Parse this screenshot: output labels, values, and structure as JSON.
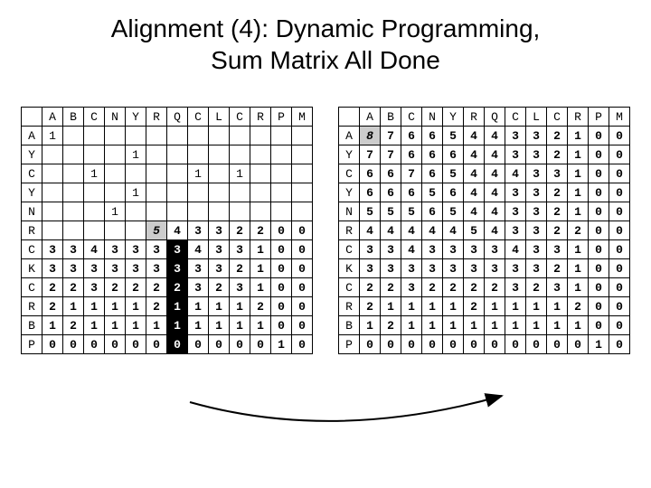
{
  "title_line1": "Alignment (4): Dynamic Programming,",
  "title_line2": "Sum Matrix All Done",
  "left_table": {
    "col_hdr": [
      "",
      "A",
      "B",
      "C",
      "N",
      "Y",
      "R",
      "Q",
      "C",
      "L",
      "C",
      "R",
      "P",
      "M"
    ],
    "rows": [
      {
        "hdr": "A",
        "cells": [
          "1",
          "",
          "",
          "",
          "",
          "",
          "",
          "",
          "",
          "",
          "",
          "",
          ""
        ]
      },
      {
        "hdr": "Y",
        "cells": [
          "",
          "",
          "",
          "",
          "1",
          "",
          "",
          "",
          "",
          "",
          "",
          "",
          ""
        ]
      },
      {
        "hdr": "C",
        "cells": [
          "",
          "",
          "1",
          "",
          "",
          "",
          "",
          "1",
          "",
          "1",
          "",
          "",
          ""
        ]
      },
      {
        "hdr": "Y",
        "cells": [
          "",
          "",
          "",
          "",
          "1",
          "",
          "",
          "",
          "",
          "",
          "",
          "",
          ""
        ]
      },
      {
        "hdr": "N",
        "cells": [
          "",
          "",
          "",
          "1",
          "",
          "",
          "",
          "",
          "",
          "",
          "",
          "",
          ""
        ]
      },
      {
        "hdr": "R",
        "cells": [
          "",
          "",
          "",
          "",
          "",
          "5",
          "4",
          "3",
          "3",
          "2",
          "2",
          "0",
          "0"
        ],
        "highlight_idx": 5,
        "highlight_kind": "grey"
      },
      {
        "hdr": "C",
        "cells": [
          "3",
          "3",
          "4",
          "3",
          "3",
          "3",
          "3",
          "4",
          "3",
          "3",
          "1",
          "0",
          "0"
        ],
        "highlight_idx": 6,
        "highlight_kind": "dark"
      },
      {
        "hdr": "K",
        "cells": [
          "3",
          "3",
          "3",
          "3",
          "3",
          "3",
          "3",
          "3",
          "3",
          "2",
          "1",
          "0",
          "0"
        ],
        "highlight_idx": 6,
        "highlight_kind": "dark"
      },
      {
        "hdr": "C",
        "cells": [
          "2",
          "2",
          "3",
          "2",
          "2",
          "2",
          "2",
          "3",
          "2",
          "3",
          "1",
          "0",
          "0"
        ],
        "highlight_idx": 6,
        "highlight_kind": "dark"
      },
      {
        "hdr": "R",
        "cells": [
          "2",
          "1",
          "1",
          "1",
          "1",
          "2",
          "1",
          "1",
          "1",
          "1",
          "2",
          "0",
          "0"
        ],
        "highlight_idx": 6,
        "highlight_kind": "dark"
      },
      {
        "hdr": "B",
        "cells": [
          "1",
          "2",
          "1",
          "1",
          "1",
          "1",
          "1",
          "1",
          "1",
          "1",
          "1",
          "0",
          "0"
        ],
        "highlight_idx": 6,
        "highlight_kind": "dark"
      },
      {
        "hdr": "P",
        "cells": [
          "0",
          "0",
          "0",
          "0",
          "0",
          "0",
          "0",
          "0",
          "0",
          "0",
          "0",
          "1",
          "0"
        ],
        "highlight_idx": 6,
        "highlight_kind": "dark"
      }
    ]
  },
  "right_table": {
    "col_hdr": [
      "",
      "A",
      "B",
      "C",
      "N",
      "Y",
      "R",
      "Q",
      "C",
      "L",
      "C",
      "R",
      "P",
      "M"
    ],
    "rows": [
      {
        "hdr": "A",
        "cells": [
          "8",
          "7",
          "6",
          "6",
          "5",
          "4",
          "4",
          "3",
          "3",
          "2",
          "1",
          "0",
          "0"
        ],
        "highlight_idx": 0,
        "highlight_kind": "grey"
      },
      {
        "hdr": "Y",
        "cells": [
          "7",
          "7",
          "6",
          "6",
          "6",
          "4",
          "4",
          "3",
          "3",
          "2",
          "1",
          "0",
          "0"
        ]
      },
      {
        "hdr": "C",
        "cells": [
          "6",
          "6",
          "7",
          "6",
          "5",
          "4",
          "4",
          "4",
          "3",
          "3",
          "1",
          "0",
          "0"
        ]
      },
      {
        "hdr": "Y",
        "cells": [
          "6",
          "6",
          "6",
          "5",
          "6",
          "4",
          "4",
          "3",
          "3",
          "2",
          "1",
          "0",
          "0"
        ]
      },
      {
        "hdr": "N",
        "cells": [
          "5",
          "5",
          "5",
          "6",
          "5",
          "4",
          "4",
          "3",
          "3",
          "2",
          "1",
          "0",
          "0"
        ]
      },
      {
        "hdr": "R",
        "cells": [
          "4",
          "4",
          "4",
          "4",
          "4",
          "5",
          "4",
          "3",
          "3",
          "2",
          "2",
          "0",
          "0"
        ]
      },
      {
        "hdr": "C",
        "cells": [
          "3",
          "3",
          "4",
          "3",
          "3",
          "3",
          "3",
          "4",
          "3",
          "3",
          "1",
          "0",
          "0"
        ]
      },
      {
        "hdr": "K",
        "cells": [
          "3",
          "3",
          "3",
          "3",
          "3",
          "3",
          "3",
          "3",
          "3",
          "2",
          "1",
          "0",
          "0"
        ]
      },
      {
        "hdr": "C",
        "cells": [
          "2",
          "2",
          "3",
          "2",
          "2",
          "2",
          "2",
          "3",
          "2",
          "3",
          "1",
          "0",
          "0"
        ]
      },
      {
        "hdr": "R",
        "cells": [
          "2",
          "1",
          "1",
          "1",
          "1",
          "2",
          "1",
          "1",
          "1",
          "1",
          "2",
          "0",
          "0"
        ]
      },
      {
        "hdr": "B",
        "cells": [
          "1",
          "2",
          "1",
          "1",
          "1",
          "1",
          "1",
          "1",
          "1",
          "1",
          "1",
          "0",
          "0"
        ]
      },
      {
        "hdr": "P",
        "cells": [
          "0",
          "0",
          "0",
          "0",
          "0",
          "0",
          "0",
          "0",
          "0",
          "0",
          "0",
          "1",
          "0"
        ]
      }
    ]
  }
}
